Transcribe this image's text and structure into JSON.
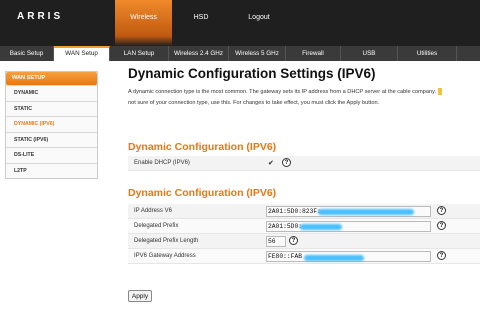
{
  "brand": "ARRIS",
  "top_nav": [
    "Wireless",
    "HSD",
    "Logout"
  ],
  "tabs": [
    "Basic Setup",
    "WAN Setup",
    "LAN Setup",
    "Wireless 2.4 GHz",
    "Wireless 5 GHz",
    "Firewall",
    "USB",
    "Utilities"
  ],
  "active_tab": "WAN Setup",
  "sidebar": {
    "header": "WAN SETUP",
    "items": [
      "DYNAMIC",
      "STATIC",
      "DYNAMIC (IPV6)",
      "STATIC (IPV6)",
      "DS-LITE",
      "L2TP"
    ],
    "active": "DYNAMIC (IPV6)"
  },
  "page": {
    "title": "Dynamic Configuration Settings (IPV6)",
    "desc_line1": "A dynamic connection type is the most common. The gateway sets its IP address from a DHCP server at the cable company.",
    "desc_line2": "not sure of your connection type, use this. For changes to take effect, you must click the Apply button."
  },
  "section1": {
    "title": "Dynamic Configuration (IPV6)",
    "enable_dhcp_label": "Enable DHCP (IPV6)",
    "enable_dhcp_checked": true
  },
  "section2": {
    "title": "Dynamic Configuration (IPV6)",
    "rows": [
      {
        "label": "IP Address V6",
        "value": "2A01:5D0:823F:"
      },
      {
        "label": "Delegated Prefix",
        "value": "2A01:5D0:"
      },
      {
        "label": "Delegated Prefix Length",
        "value": "56"
      },
      {
        "label": "IPV6 Gateway Address",
        "value": "FE80::FAB"
      }
    ]
  },
  "help_glyph": "?",
  "checkmark": "✔",
  "apply_label": "Apply",
  "colors": {
    "accent": "#e87810",
    "topbar": "#1f1f1f",
    "tabbar": "#3a3a3a"
  }
}
